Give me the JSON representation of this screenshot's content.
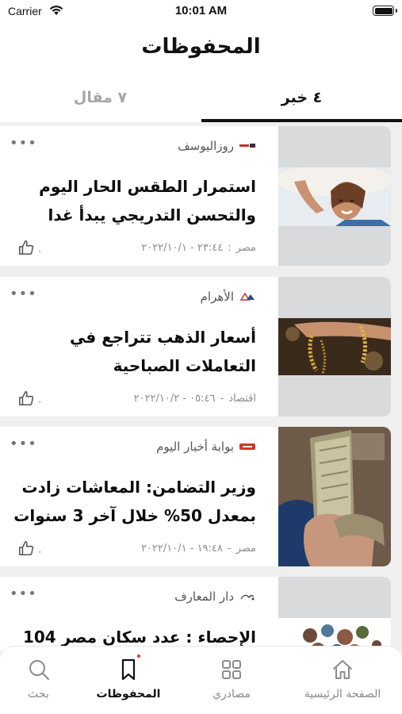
{
  "status_bar": {
    "carrier": "Carrier",
    "time": "10:01 AM"
  },
  "header": {
    "title": "المحفوظات"
  },
  "tabs": [
    {
      "label": "٤ خبر",
      "active": true
    },
    {
      "label": "٧ مقال",
      "active": false
    }
  ],
  "articles": [
    {
      "source": "روزاليوسف",
      "headline": "استمرار الطقس الحار اليوم والتحسن التدريجي يبدأ غدا",
      "category": "مصر",
      "datetime": "٢٣:٤٤ - ٢٠٢٢/١٠/١",
      "likes": "٠",
      "menu": "•••",
      "logo_icon": "rose-alyoussef-logo-icon",
      "photo_icon": "woman-sun-hat-photo"
    },
    {
      "source": "الأهرام",
      "headline": "أسعار الذهب تتراجع في التعاملات الصباحية",
      "category": "اقتصاد",
      "datetime": "٠٥:٤٦ - ٢٠٢٢/١٠/٢",
      "likes": "٠",
      "menu": "•••",
      "logo_icon": "ahram-logo-icon",
      "photo_icon": "gold-jewelry-photo"
    },
    {
      "source": "بوابة أخبار اليوم",
      "headline": "وزير التضامن: المعاشات زادت بمعدل 50% خلال آخر 3 سنوات",
      "category": "مصر",
      "datetime": "١٩:٤٨ - ٢٠٢٢/١٠/١",
      "likes": "٠",
      "menu": "•••",
      "logo_icon": "akhbar-elyom-logo-icon",
      "photo_icon": "banknotes-photo"
    },
    {
      "source": "دار المعارف",
      "headline": "الإحصاء : عدد سكان مصر 104",
      "menu": "•••",
      "logo_icon": "dar-almaaref-logo-icon",
      "photo_icon": "crowd-figures-photo"
    }
  ],
  "bottom_tabs": [
    {
      "label": "الصفحة الرئيسية",
      "icon": "home-icon"
    },
    {
      "label": "مصادري",
      "icon": "grid-icon"
    },
    {
      "label": "المحفوظات",
      "icon": "bookmark-icon",
      "active": true
    },
    {
      "label": "بحث",
      "icon": "search-icon"
    }
  ],
  "colors": {
    "accent": "#111111",
    "inactive_tab": "#a6a6a6",
    "badge_dot": "#e0302b",
    "background": "#efefef"
  }
}
